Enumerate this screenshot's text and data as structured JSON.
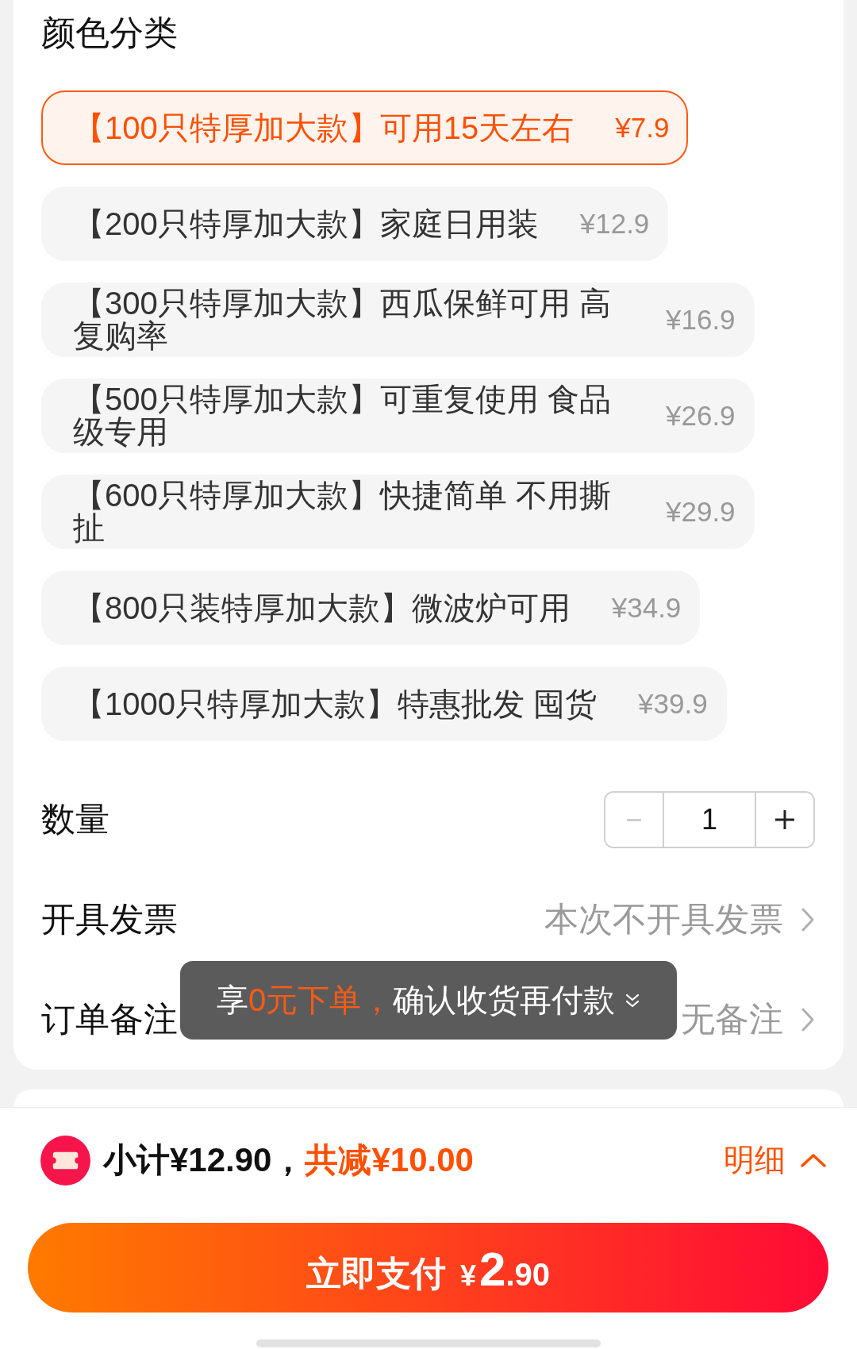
{
  "section_title": "颜色分类",
  "options": [
    {
      "label": "【100只特厚加大款】可用15天左右",
      "price": "¥7.9",
      "selected": true
    },
    {
      "label": "【200只特厚加大款】家庭日用装",
      "price": "¥12.9",
      "selected": false
    },
    {
      "label": "【300只特厚加大款】西瓜保鲜可用 高复购率",
      "price": "¥16.9",
      "selected": false
    },
    {
      "label": "【500只特厚加大款】可重复使用 食品级专用",
      "price": "¥26.9",
      "selected": false
    },
    {
      "label": "【600只特厚加大款】快捷简单 不用撕扯",
      "price": "¥29.9",
      "selected": false
    },
    {
      "label": "【800只装特厚加大款】微波炉可用",
      "price": "¥34.9",
      "selected": false
    },
    {
      "label": "【1000只特厚加大款】特惠批发 囤货",
      "price": "¥39.9",
      "selected": false
    }
  ],
  "quantity": {
    "label": "数量",
    "value": "1",
    "decrement_disabled": true
  },
  "rows": [
    {
      "label": "开具发票",
      "value": "本次不开具发票"
    },
    {
      "label": "订单备注",
      "value": "无备注"
    }
  ],
  "toast": {
    "segments": [
      {
        "text": "享",
        "highlight": false
      },
      {
        "text": "0元下单，",
        "highlight": true
      },
      {
        "text": "确认收货再付款",
        "highlight": false
      }
    ]
  },
  "summary": {
    "subtotal": "小计¥12.90，",
    "discount": "共减¥10.00",
    "details": "明细"
  },
  "pay_button": {
    "label": "立即支付",
    "currency": "¥",
    "integer": "2",
    "decimal": ".90"
  }
}
